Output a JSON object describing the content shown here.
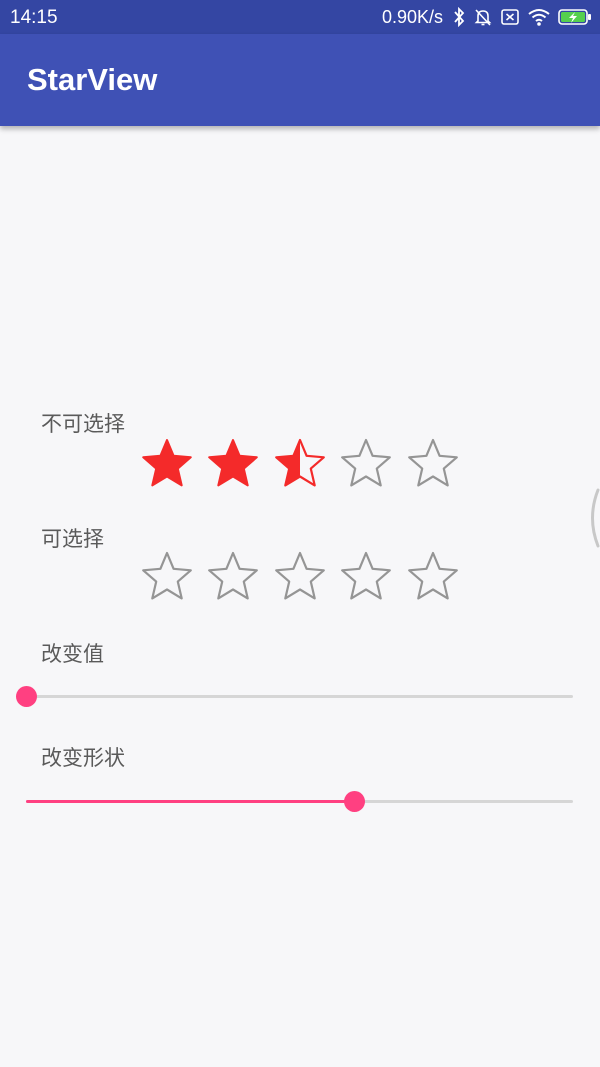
{
  "status_bar": {
    "time": "14:15",
    "network_speed": "0.90K/s",
    "icons": [
      "bluetooth-icon",
      "alarm-off-icon",
      "sim-off-icon",
      "wifi-icon",
      "battery-charging-icon"
    ]
  },
  "app_bar": {
    "title": "StarView",
    "color": "#3f51b5",
    "status_color": "#3446a3"
  },
  "sections": {
    "readonly_label": "不可选择",
    "selectable_label": "可选择",
    "change_value_label": "改变值",
    "change_shape_label": "改变形状"
  },
  "readonly_rating": {
    "total": 5,
    "rating": 2.5
  },
  "selectable_rating": {
    "total": 5,
    "rating": 0
  },
  "change_value_slider": {
    "value": 0.0
  },
  "change_shape_slider": {
    "value": 0.6
  },
  "colors": {
    "star_fill": "#f42a2a",
    "star_empty_stroke": "#959595",
    "accent": "#ff4081"
  }
}
